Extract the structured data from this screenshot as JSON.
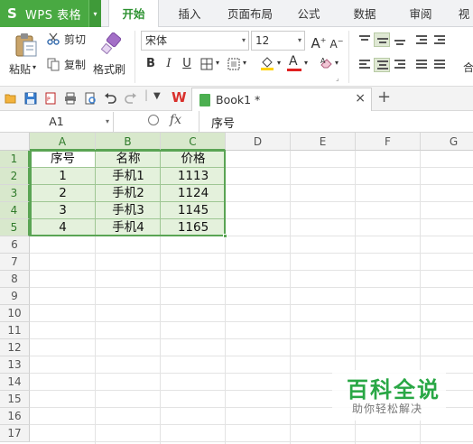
{
  "app": {
    "logo": "S",
    "name": "WPS 表格",
    "caret": "▾"
  },
  "menu": {
    "tabs": [
      "开始",
      "插入",
      "页面布局",
      "公式",
      "数据",
      "审阅",
      "视"
    ],
    "active": "开始"
  },
  "ribbon": {
    "paste_label": "粘贴",
    "cut_label": "剪切",
    "copy_label": "复制",
    "format_painter_label": "格式刷",
    "font_name": "宋体",
    "font_size": "12",
    "grow_font": "A",
    "shrink_font": "A",
    "bold": "B",
    "italic": "I",
    "underline": "U",
    "font_color_letter": "A",
    "merge_label": "合"
  },
  "quickbar": {
    "wps_logo": "W",
    "document_tab": "Book1 *",
    "close_glyph": "×",
    "new_tab_glyph": "+"
  },
  "formula_bar": {
    "cell_ref": "A1",
    "fx_label": "fx",
    "content": "序号"
  },
  "sheet": {
    "columns": [
      "A",
      "B",
      "C",
      "D",
      "E",
      "F",
      "G"
    ],
    "rows": [
      "1",
      "2",
      "3",
      "4",
      "5",
      "6",
      "7",
      "8",
      "9",
      "10",
      "11",
      "12",
      "13",
      "14",
      "15",
      "16",
      "17"
    ],
    "selected_columns": [
      "A",
      "B",
      "C"
    ],
    "selected_rows": [
      "1",
      "2",
      "3",
      "4",
      "5"
    ],
    "data": [
      [
        "序号",
        "名称",
        "价格"
      ],
      [
        "1",
        "手机1",
        "1113"
      ],
      [
        "2",
        "手机2",
        "1124"
      ],
      [
        "3",
        "手机3",
        "1145"
      ],
      [
        "4",
        "手机4",
        "1165"
      ]
    ]
  },
  "watermark": {
    "title": "百科全说",
    "subtitle": "助你轻松解决"
  },
  "colors": {
    "brand_green": "#49a942",
    "selection_border": "#5aa454",
    "selection_fill": "#e4f1dc"
  }
}
